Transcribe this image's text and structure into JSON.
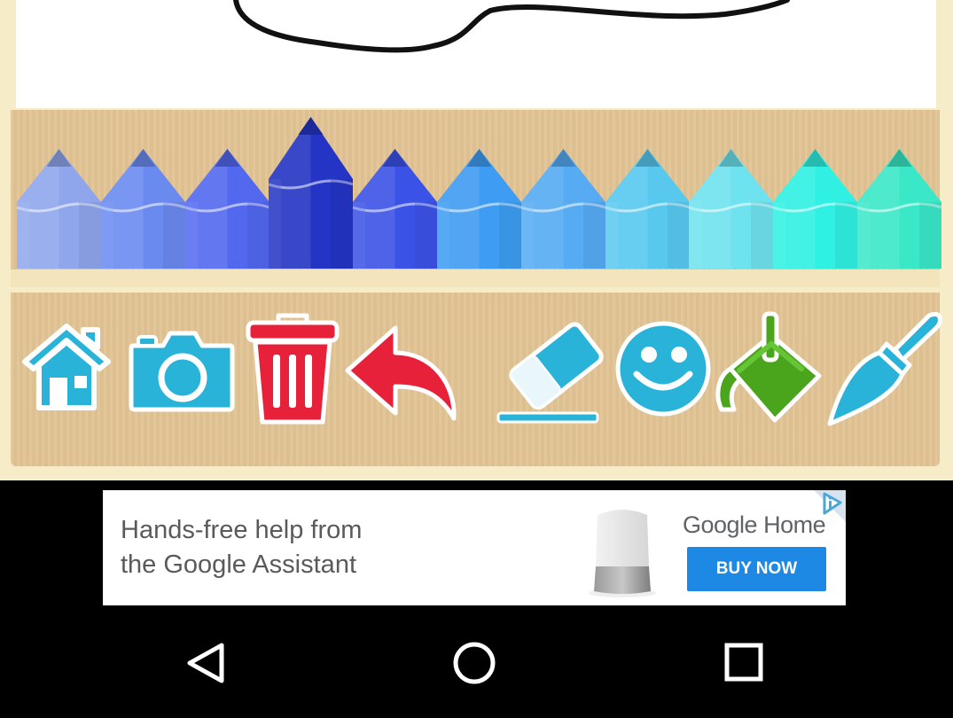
{
  "colors": {
    "wood": "#e2c494",
    "frame": "#f6ecc8",
    "tool_blue": "#2ab3d8",
    "trash_red": "#e8213a",
    "bucket_green": "#4aa51c",
    "ad_button": "#1e88e5"
  },
  "palette": {
    "selected_index": 3,
    "pencils": [
      {
        "name": "periwinkle",
        "color": "#8fa6ec"
      },
      {
        "name": "cornflower",
        "color": "#6b8af0"
      },
      {
        "name": "royal-blue",
        "color": "#5268ef"
      },
      {
        "name": "dark-blue",
        "color": "#2434c4"
      },
      {
        "name": "medium-blue",
        "color": "#3b52e6"
      },
      {
        "name": "azure",
        "color": "#3e9cf2"
      },
      {
        "name": "sky-blue",
        "color": "#56abf3"
      },
      {
        "name": "light-sky",
        "color": "#58c8ef"
      },
      {
        "name": "pale-cyan",
        "color": "#6ee2ee"
      },
      {
        "name": "aqua",
        "color": "#2ff0e2"
      },
      {
        "name": "turquoise",
        "color": "#3ae8c8"
      }
    ]
  },
  "toolbar": {
    "home_icon": "home-icon",
    "camera_icon": "camera-icon",
    "trash_icon": "trash-icon",
    "undo_icon": "undo-arrow-icon",
    "eraser_icon": "eraser-icon",
    "sticker_icon": "smiley-face-icon",
    "fill_icon": "paint-bucket-icon",
    "brush_icon": "paintbrush-icon"
  },
  "ad": {
    "line1": "Hands-free help from",
    "line2": "the Google Assistant",
    "brand": "Google Home",
    "cta": "BUY NOW",
    "product_icon": "smart-speaker-image",
    "badge_icon": "adchoices-icon"
  },
  "navbar": {
    "back_icon": "back-triangle-icon",
    "home_icon": "home-circle-icon",
    "recents_icon": "recents-square-icon"
  }
}
